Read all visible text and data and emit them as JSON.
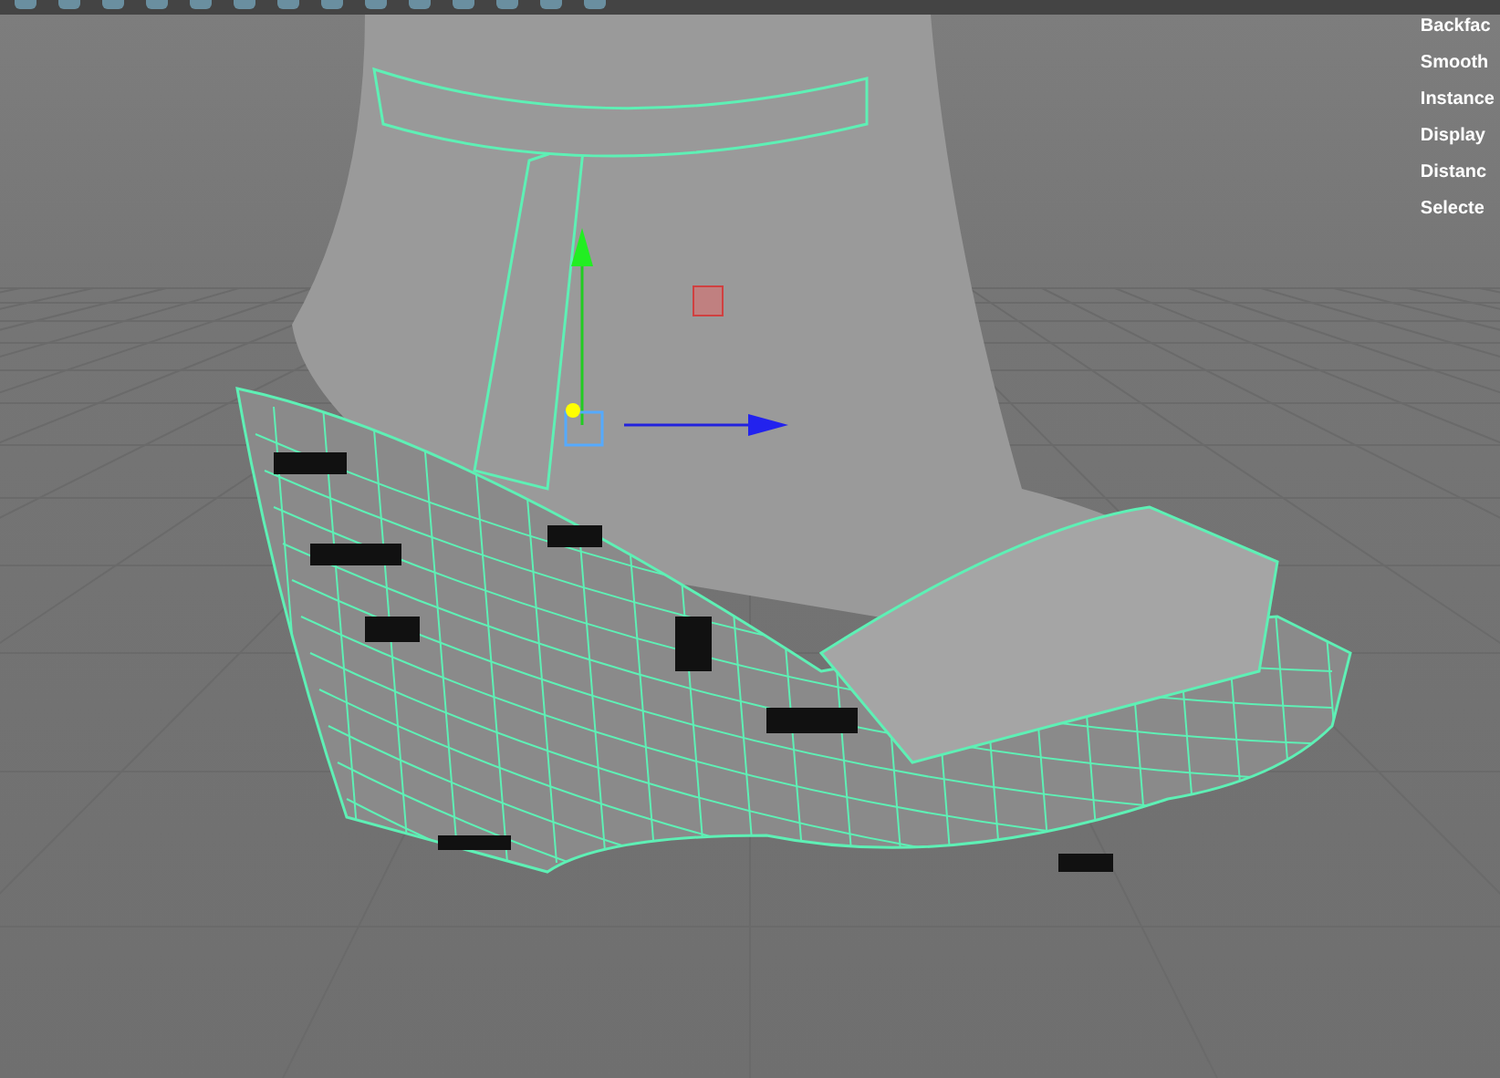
{
  "hud": {
    "items": [
      "Backfac",
      "Smooth",
      "Instance",
      "Display",
      "Distanc",
      "Selecte"
    ]
  }
}
